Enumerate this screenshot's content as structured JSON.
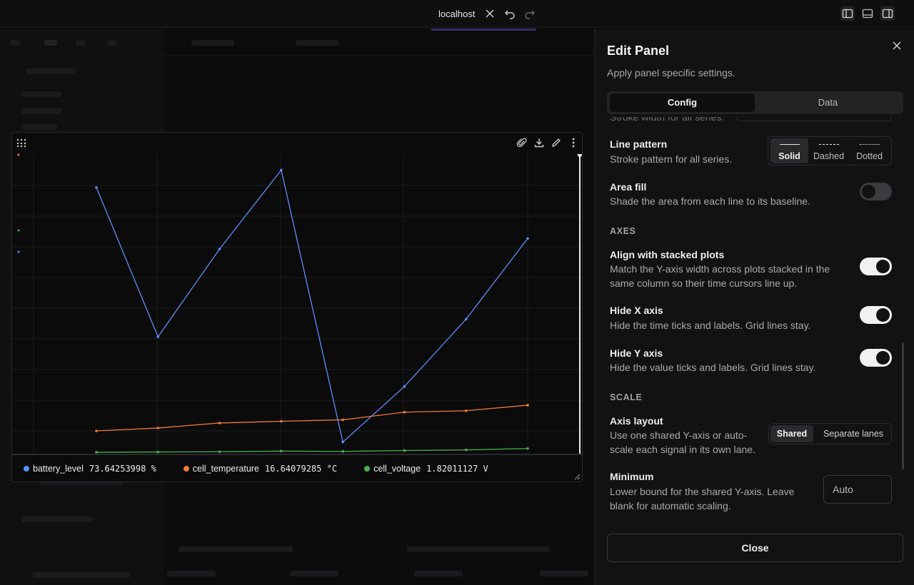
{
  "titlebar": {
    "title": "localhost",
    "icons": [
      "close-icon",
      "undo-icon",
      "redo-icon",
      "sidebar-left-icon",
      "panel-bottom-icon",
      "sidebar-right-icon"
    ]
  },
  "plot_panel": {
    "toolbar_icons": [
      "drag-grid-icon",
      "paperclip-icon",
      "download-icon",
      "edit-icon",
      "more-vertical-icon"
    ],
    "legend": [
      {
        "name": "battery_level",
        "value": "73.64253998 %",
        "color": "#5b8ff9"
      },
      {
        "name": "cell_temperature",
        "value": "16.64079285 °C",
        "color": "#f07a36"
      },
      {
        "name": "cell_voltage",
        "value": "1.82011127 V",
        "color": "#4caf50"
      }
    ]
  },
  "chart_data": {
    "type": "line",
    "x": [
      1,
      2,
      3,
      4,
      5,
      6,
      7,
      8
    ],
    "series": [
      {
        "name": "battery_level",
        "color": "#5b8ff9",
        "values": [
          91,
          40,
          70,
          97,
          4,
          23,
          46,
          73.6
        ]
      },
      {
        "name": "cell_temperature",
        "color": "#f07a36",
        "values": [
          7.8,
          8.8,
          10.5,
          11.1,
          11.6,
          14.2,
          14.7,
          16.6
        ]
      },
      {
        "name": "cell_voltage",
        "color": "#4caf50",
        "values": [
          0.5,
          0.6,
          0.7,
          0.9,
          0.8,
          1.1,
          1.3,
          1.8
        ]
      }
    ],
    "ylim": [
      0,
      100
    ],
    "grid": true,
    "x_axis_hidden": true,
    "y_axis_hidden": true,
    "legend_placement": "bottom"
  },
  "edit_panel": {
    "title": "Edit Panel",
    "subtitle": "Apply panel specific settings.",
    "tabs": [
      {
        "label": "Config",
        "active": true
      },
      {
        "label": "Data",
        "active": false
      }
    ],
    "cutoff_text": "Stroke width for all series.",
    "line_pattern": {
      "title": "Line pattern",
      "desc": "Stroke pattern for all series.",
      "options": [
        {
          "label": "Solid",
          "active": true
        },
        {
          "label": "Dashed",
          "active": false
        },
        {
          "label": "Dotted",
          "active": false
        }
      ]
    },
    "area_fill": {
      "title": "Area fill",
      "desc": "Shade the area from each line to its baseline.",
      "on": false
    },
    "axes_header": "AXES",
    "align_stacked": {
      "title": "Align with stacked plots",
      "desc": "Match the Y-axis width across plots stacked in the same column so their time cursors line up.",
      "on": true
    },
    "hide_x": {
      "title": "Hide X axis",
      "desc": "Hide the time ticks and labels. Grid lines stay.",
      "on": true
    },
    "hide_y": {
      "title": "Hide Y axis",
      "desc": "Hide the value ticks and labels. Grid lines stay.",
      "on": true
    },
    "scale_header": "SCALE",
    "axis_layout": {
      "title": "Axis layout",
      "desc": "Use one shared Y-axis or auto-scale each signal in its own lane.",
      "options": [
        {
          "label": "Shared",
          "active": true
        },
        {
          "label": "Separate lanes",
          "active": false
        }
      ]
    },
    "minimum": {
      "title": "Minimum",
      "desc": "Lower bound for the shared Y-axis. Leave blank for automatic scaling.",
      "placeholder": "Auto"
    },
    "close_label": "Close"
  }
}
